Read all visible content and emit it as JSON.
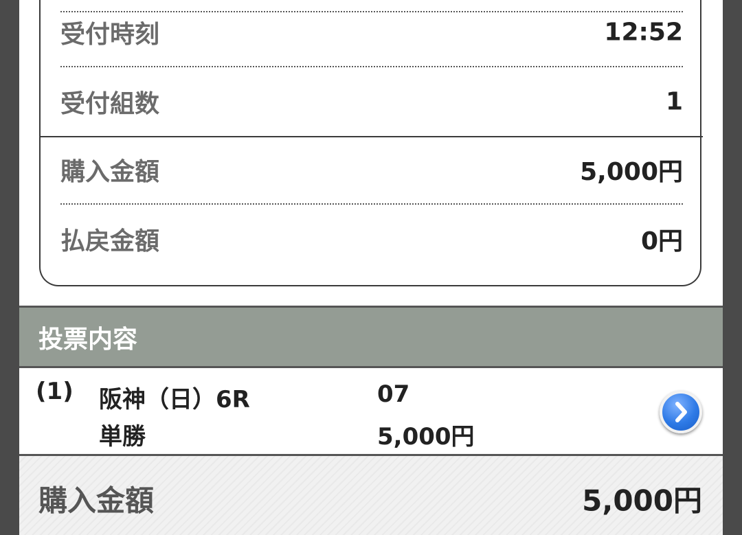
{
  "summary": {
    "rows": [
      {
        "label": "受付時刻",
        "value": "12:52"
      },
      {
        "label": "受付組数",
        "value": "1"
      },
      {
        "label": "購入金額",
        "value": "5,000円"
      },
      {
        "label": "払戻金額",
        "value": "0円"
      }
    ]
  },
  "section": {
    "title": "投票内容"
  },
  "bet": {
    "index": "(1)",
    "race": "阪神（日）6R",
    "type": "単勝",
    "selection": "07",
    "amount": "5,000円",
    "detail_icon": "chevron-right-icon"
  },
  "total": {
    "label": "購入金額",
    "value": "5,000円"
  },
  "colors": {
    "section_header_bg": "#949c94",
    "arrow_button": "#2e7ae6"
  }
}
